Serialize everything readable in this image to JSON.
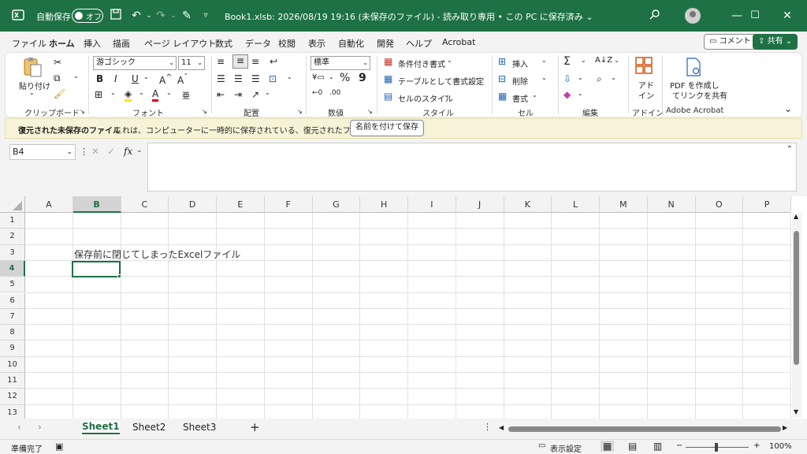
{
  "titlebar": {
    "autosave_label": "自動保存",
    "autosave_state": "オフ",
    "doc_title": "Book1.xlsb: 2026/08/19 19:16 (未保存のファイル) - 読み取り専用 • この PC に保存済み ⌄",
    "icons": [
      "excel-icon",
      "save-icon",
      "undo-icon",
      "redo-icon",
      "format-painter-icon",
      "customize-icon",
      "search-icon",
      "avatar",
      "minimize-icon",
      "maximize-icon",
      "close-icon"
    ]
  },
  "menu": {
    "tabs": [
      "ファイル",
      "ホーム",
      "挿入",
      "描画",
      "ページ レイアウト",
      "数式",
      "データ",
      "校閲",
      "表示",
      "自動化",
      "開発",
      "ヘルプ",
      "Acrobat"
    ],
    "active": "ホーム",
    "comment_label": "コメント",
    "share_label": "共有"
  },
  "ribbon": {
    "clipboard": {
      "paste_label": "貼り付け",
      "group": "クリップボード"
    },
    "font": {
      "font_name": "游ゴシック",
      "font_size": "11",
      "group": "フォント"
    },
    "alignment": {
      "group": "配置"
    },
    "number": {
      "format": "標準",
      "group": "数値"
    },
    "styles": {
      "conditional": "条件付き書式",
      "table": "テーブルとして書式設定",
      "cell_styles": "セルのスタイル",
      "group": "スタイル"
    },
    "cells": {
      "insert": "挿入",
      "delete": "削除",
      "format": "書式",
      "group": "セル"
    },
    "editing": {
      "group": "編集"
    },
    "addins": {
      "label1": "アド",
      "label2": "イン",
      "group": "アドイン"
    },
    "acrobat": {
      "label1": "PDF を作成し",
      "label2": "てリンクを共有",
      "group": "Adobe Acrobat"
    }
  },
  "infobar": {
    "title": "復元された未保存のファイル",
    "message": "これは、コンピューターに一時的に保存されている、復元されたファイルです。",
    "button": "名前を付けて保存"
  },
  "formula": {
    "namebox": "B4",
    "fx": "fx",
    "content": ""
  },
  "grid": {
    "columns": [
      "A",
      "B",
      "C",
      "D",
      "E",
      "F",
      "G",
      "H",
      "I",
      "J",
      "K",
      "L",
      "M",
      "N",
      "O",
      "P"
    ],
    "rows": [
      "1",
      "2",
      "3",
      "4",
      "5",
      "6",
      "7",
      "8",
      "9",
      "10",
      "11",
      "12",
      "13"
    ],
    "selected_cell": "B4",
    "cell_B3": "保存前に閉じてしまったExcelファイル"
  },
  "sheets": {
    "tabs": [
      "Sheet1",
      "Sheet2",
      "Sheet3"
    ],
    "active": "Sheet1",
    "add": "+"
  },
  "status": {
    "ready": "準備完了",
    "display_settings": "表示設定",
    "zoom": "100%",
    "zoom_minus": "−",
    "zoom_plus": "+"
  }
}
